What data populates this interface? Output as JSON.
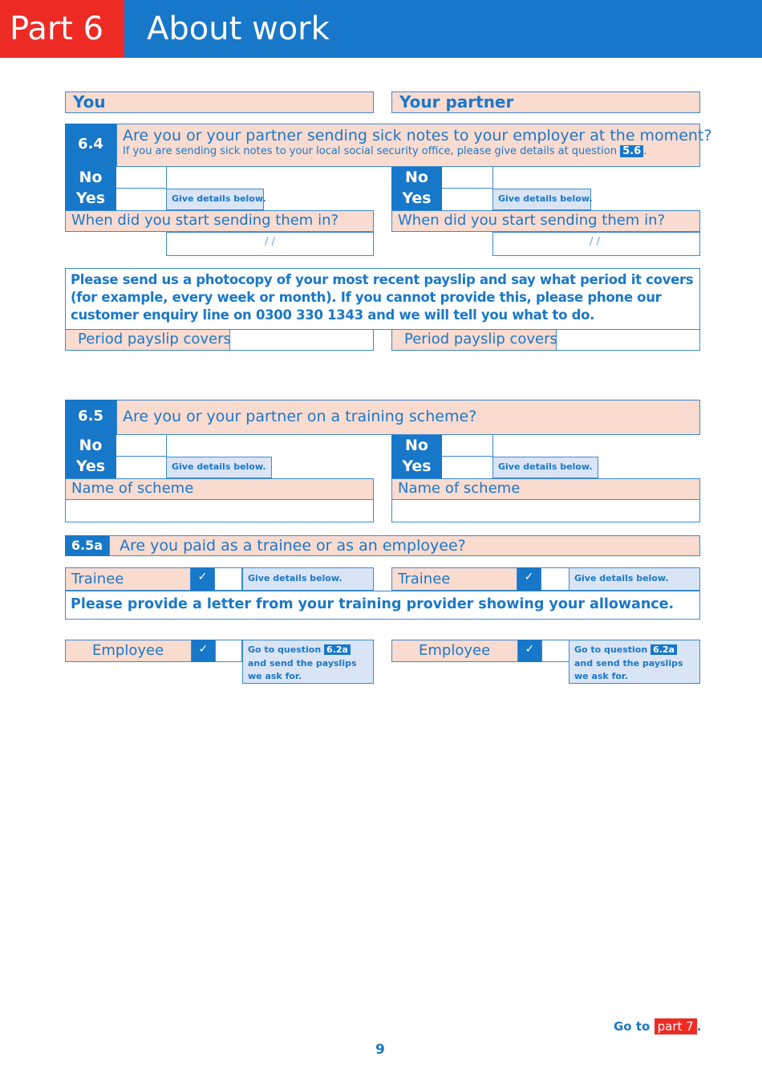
{
  "header": {
    "part_label": "Part 6",
    "title": "About work"
  },
  "columns": {
    "you": "You",
    "partner": "Your partner"
  },
  "q6_4": {
    "number": "6.4",
    "question": "Are you or your partner sending sick notes to your employer at the moment?",
    "note": "If you are sending sick notes to your local social security office, please give details at question",
    "note_ref": "5.6",
    "note_end": ".",
    "no_label": "No",
    "yes_label": "Yes",
    "give_details": "Give details below.",
    "start_label": "When did you start sending them in?",
    "date_sep": "/     /"
  },
  "payslip": {
    "instruction": "Please send us a photocopy of your most recent payslip and say what period it covers (for example, every week or month).  If you cannot provide this, please phone our customer enquiry line on 0300 330 1343 and we will tell you what to do.",
    "period_label": "Period payslip covers"
  },
  "q6_5": {
    "number": "6.5",
    "question": "Are you or your partner on a training scheme?",
    "no_label": "No",
    "yes_label": "Yes",
    "give_details": "Give details below.",
    "scheme_label": "Name of scheme"
  },
  "q6_5a": {
    "number": "6.5a",
    "question": "Are you paid as a trainee or as an employee?",
    "trainee_label": "Trainee",
    "employee_label": "Employee",
    "check": "✓",
    "give_details": "Give details below.",
    "letter_note": "Please provide a letter from your training provider showing your allowance.",
    "goto_q_prefix": "Go to question",
    "goto_q_ref": "6.2a",
    "goto_line2": "and send the payslips",
    "goto_line3": "we ask for."
  },
  "footer": {
    "goto_prefix": "Go to",
    "goto_ref": "part 7",
    "goto_end": ".",
    "page_number": "9"
  }
}
